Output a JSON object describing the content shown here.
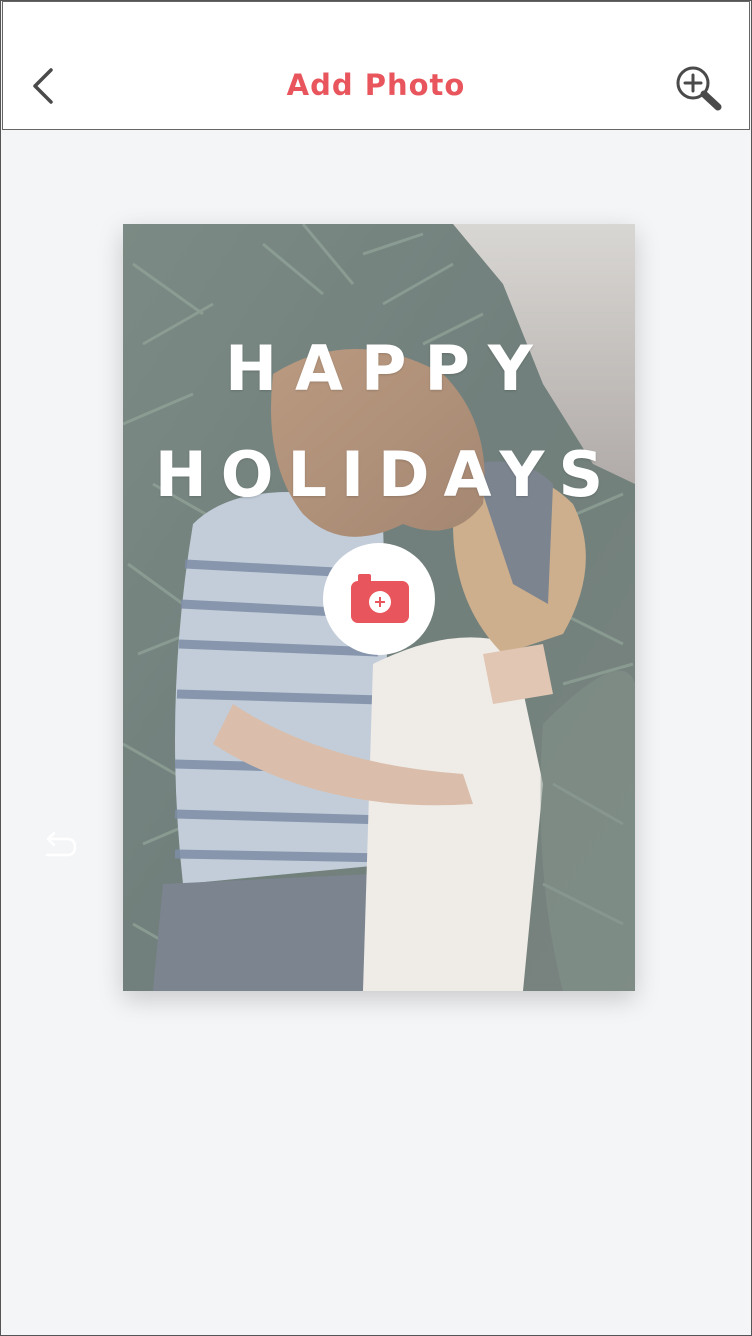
{
  "header": {
    "title": "Add Photo",
    "back_icon": "chevron-left-icon",
    "zoom_icon": "zoom-in-icon"
  },
  "card": {
    "line1": "HAPPY",
    "line2": "HOLIDAYS",
    "add_photo_icon": "camera-plus-icon"
  },
  "side": {
    "undo_icon": "undo-icon"
  },
  "colors": {
    "accent": "#e8555c",
    "background": "#f4f5f7",
    "header_bg": "#ffffff",
    "icon": "#4a4a4a"
  }
}
